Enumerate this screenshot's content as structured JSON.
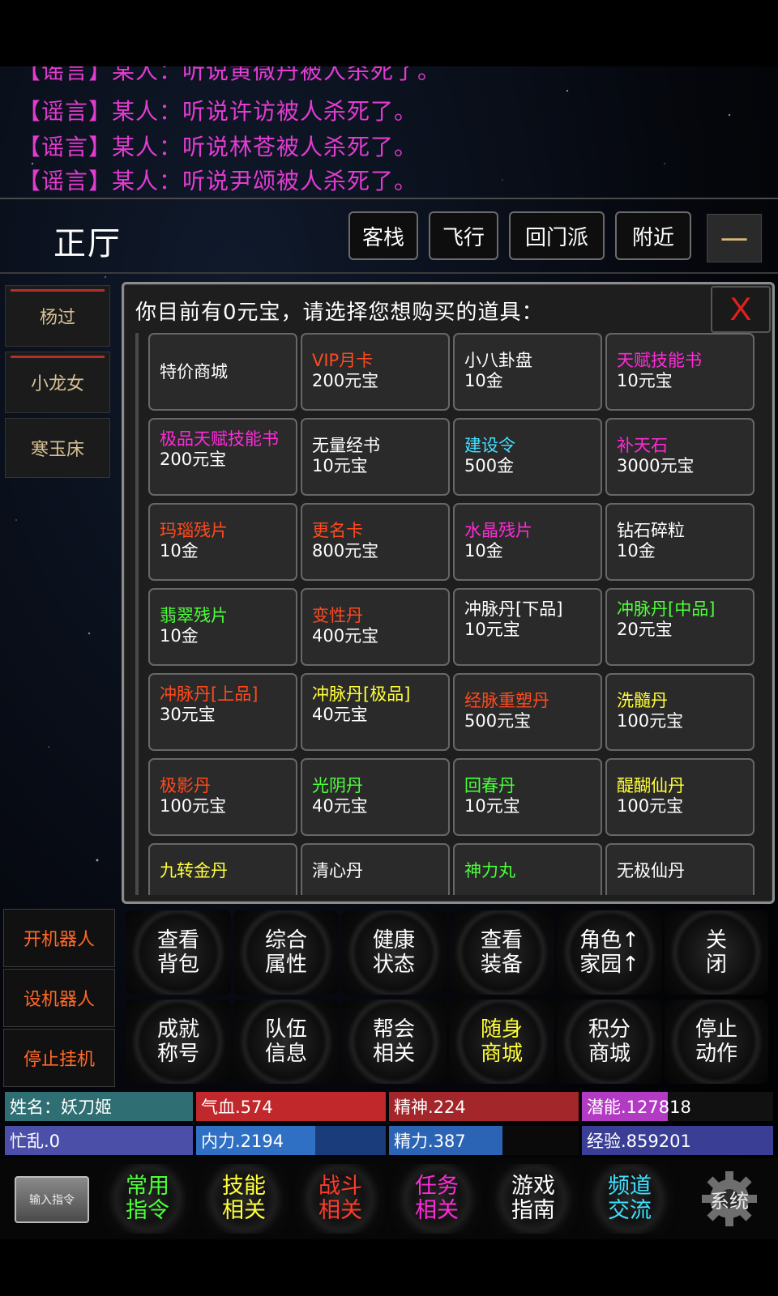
{
  "rumors": [
    "【谣言】某人：听说黄微丹被人杀死了。",
    "【谣言】某人：听说许访被人杀死了。",
    "【谣言】某人：听说林苍被人杀死了。",
    "【谣言】某人：听说尹颂被人杀死了。"
  ],
  "room": {
    "title": "正厅"
  },
  "nav": {
    "inn": "客栈",
    "fly": "飞行",
    "return_sect": "回门派",
    "nearby": "附近",
    "minimize": "一"
  },
  "npcs": [
    "杨过",
    "小龙女",
    "寒玉床"
  ],
  "shop": {
    "title": "你目前有0元宝，请选择您想购买的道具：",
    "close_label": "X",
    "items": [
      {
        "name": "特价商城",
        "price": "",
        "color": "#ffffff"
      },
      {
        "name": "VIP月卡",
        "price": "200元宝",
        "color": "#ff4a1e"
      },
      {
        "name": "小八卦盘",
        "price": "10金",
        "color": "#ffffff"
      },
      {
        "name": "天赋技能书",
        "price": "10元宝",
        "color": "#ff2bd8"
      },
      {
        "name": "极品天赋技能书",
        "price": "200元宝",
        "color": "#ff2bd8"
      },
      {
        "name": "无量经书",
        "price": "10元宝",
        "color": "#ffffff"
      },
      {
        "name": "建设令",
        "price": "500金",
        "color": "#40e0ff"
      },
      {
        "name": "补天石",
        "price": "3000元宝",
        "color": "#ff2bd8"
      },
      {
        "name": "玛瑙残片",
        "price": "10金",
        "color": "#ff4a1e"
      },
      {
        "name": "更名卡",
        "price": "800元宝",
        "color": "#ff4a1e"
      },
      {
        "name": "水晶残片",
        "price": "10金",
        "color": "#ff2bd8"
      },
      {
        "name": "钻石碎粒",
        "price": "10金",
        "color": "#ffffff"
      },
      {
        "name": "翡翠残片",
        "price": "10金",
        "color": "#4cff3a"
      },
      {
        "name": "变性丹",
        "price": "400元宝",
        "color": "#ff4a1e"
      },
      {
        "name": "冲脉丹[下品]",
        "price": "10元宝",
        "color": "#ffffff"
      },
      {
        "name": "冲脉丹[中品]",
        "price": "20元宝",
        "color": "#4cff3a"
      },
      {
        "name": "冲脉丹[上品]",
        "price": "30元宝",
        "color": "#ff4a1e"
      },
      {
        "name": "冲脉丹[极品]",
        "price": "40元宝",
        "color": "#ffff3a"
      },
      {
        "name": "经脉重塑丹",
        "price": "500元宝",
        "color": "#ff4a1e"
      },
      {
        "name": "洗髓丹",
        "price": "100元宝",
        "color": "#ffff3a"
      },
      {
        "name": "极影丹",
        "price": "100元宝",
        "color": "#ff4a1e"
      },
      {
        "name": "光阴丹",
        "price": "40元宝",
        "color": "#4cff3a"
      },
      {
        "name": "回春丹",
        "price": "10元宝",
        "color": "#4cff3a"
      },
      {
        "name": "醍醐仙丹",
        "price": "100元宝",
        "color": "#ffff3a"
      },
      {
        "name": "九转金丹",
        "price": "",
        "color": "#ffff3a"
      },
      {
        "name": "清心丹",
        "price": "",
        "color": "#ffffff"
      },
      {
        "name": "神力丸",
        "price": "",
        "color": "#4cff3a"
      },
      {
        "name": "无极仙丹",
        "price": "",
        "color": "#ffffff"
      }
    ]
  },
  "side_buttons": [
    "开机器人",
    "设机器人",
    "停止挂机"
  ],
  "commands": [
    {
      "label": "查看\n背包",
      "color": "#ffffff"
    },
    {
      "label": "综合\n属性",
      "color": "#ffffff"
    },
    {
      "label": "健康\n状态",
      "color": "#ffffff"
    },
    {
      "label": "查看\n装备",
      "color": "#ffffff"
    },
    {
      "label": "角色↑\n家园↑",
      "color": "#ffffff"
    },
    {
      "label": "关\n闭",
      "color": "#ffffff"
    },
    {
      "label": "成就\n称号",
      "color": "#ffffff"
    },
    {
      "label": "队伍\n信息",
      "color": "#ffffff"
    },
    {
      "label": "帮会\n相关",
      "color": "#ffffff"
    },
    {
      "label": "随身\n商城",
      "color": "#ffff3a"
    },
    {
      "label": "积分\n商城",
      "color": "#ffffff"
    },
    {
      "label": "停止\n动作",
      "color": "#ffffff"
    }
  ],
  "stats": {
    "name": "姓名：妖刀姬",
    "hp": "气血.574",
    "spirit": "精神.224",
    "potential": "潜能.127818",
    "busy": "忙乱.0",
    "neili": "内力.2194",
    "jingli": "精力.387",
    "exp": "经验.859201",
    "colors": {
      "name": "#2f6f73",
      "hp": "#c0282b",
      "spirit": "#a3262a",
      "potential": "#b33ac3",
      "busy": "#4b4fa8",
      "neili": "#2f6fc4",
      "jingli": "#2b63b5",
      "exp": "#3a3f95"
    },
    "fill": {
      "neili": 0.63,
      "jingli": 0.6,
      "potential": 0.45
    }
  },
  "bottom": {
    "input_label": "输入指令",
    "items": [
      {
        "label": "常用\n指令",
        "color": "#4cff3a"
      },
      {
        "label": "技能\n相关",
        "color": "#ffff3a"
      },
      {
        "label": "战斗\n相关",
        "color": "#ff3a2a"
      },
      {
        "label": "任务\n相关",
        "color": "#ff2bd8"
      },
      {
        "label": "游戏\n指南",
        "color": "#ffffff"
      },
      {
        "label": "频道\n交流",
        "color": "#40e0ff"
      }
    ],
    "system_label": "系统"
  }
}
